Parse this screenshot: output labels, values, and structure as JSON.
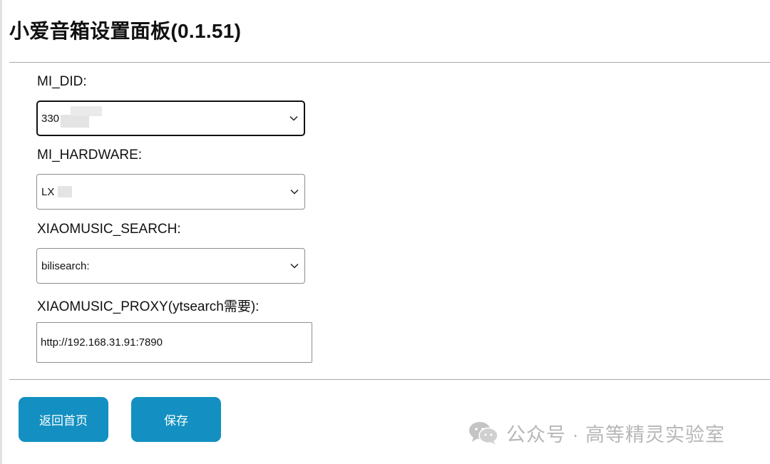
{
  "page": {
    "title": "小爱音箱设置面板(0.1.51)"
  },
  "form": {
    "mi_did": {
      "label": "MI_DID:",
      "value": "330"
    },
    "mi_hardware": {
      "label": "MI_HARDWARE:",
      "value": "LX"
    },
    "xiaomusic_search": {
      "label": "XIAOMUSIC_SEARCH:",
      "value": "bilisearch:"
    },
    "xiaomusic_proxy": {
      "label": "XIAOMUSIC_PROXY(ytsearch需要):",
      "value": "http://192.168.31.91:7890"
    }
  },
  "buttons": {
    "home_label": "返回首页",
    "save_label": "保存"
  },
  "watermark": {
    "text": "公众号 · 高等精灵实验室",
    "icon": "wechat-icon"
  },
  "colors": {
    "button_bg": "#1390c1",
    "button_text": "#ffffff",
    "watermark_text": "#b7b7b7"
  }
}
